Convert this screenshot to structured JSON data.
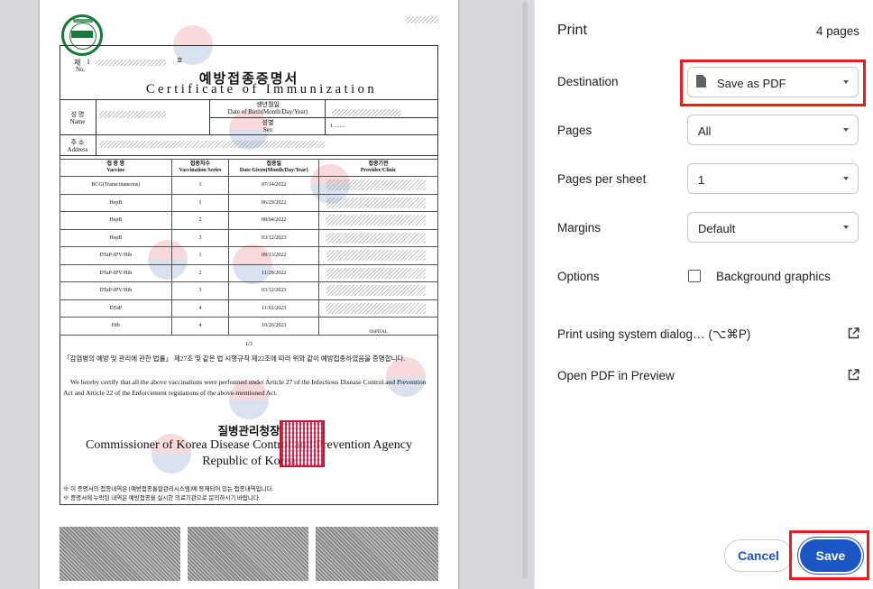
{
  "document": {
    "seal_text": "시 험 확 인 진본 2024-10 YO 17:25:06 KST 예방접종통합관리시스템",
    "number_prefix": "제",
    "number_value": "1",
    "number_suffix": "호",
    "number_en": "No.",
    "title_ko": "예방접종증명서",
    "title_en": "Certificate of Immunization",
    "name_label_ko": "성  명",
    "name_label_en": "Name",
    "dob_label_ko": "생년월일",
    "dob_label_en": "Date of Birth(Month/Day/Year)",
    "sex_label_ko": "성별",
    "sex_label_en": "Sex",
    "sex_value": "1 ........",
    "address_label_ko": "주  소",
    "address_label_en": "Address",
    "table_headers": [
      {
        "ko": "접 종 명",
        "en": "Vaccine"
      },
      {
        "ko": "접종차수",
        "en": "Vaccination Series"
      },
      {
        "ko": "접종일",
        "en": "Date Given(Month/Day/Year)"
      },
      {
        "ko": "접종기관",
        "en": "Provider/Clinic"
      }
    ],
    "rows": [
      {
        "vaccine": "BCG(Transcutaneous)",
        "series": "1",
        "date": "07/14/2022"
      },
      {
        "vaccine": "HepB",
        "series": "1",
        "date": "06/29/2022"
      },
      {
        "vaccine": "HepB",
        "series": "2",
        "date": "08/04/2022"
      },
      {
        "vaccine": "HepB",
        "series": "3",
        "date": "03/12/2023"
      },
      {
        "vaccine": "DTaP-IPV/Hib",
        "series": "1",
        "date": "09/13/2022"
      },
      {
        "vaccine": "DTaP-IPV/Hib",
        "series": "2",
        "date": "11/28/2022"
      },
      {
        "vaccine": "DTaP-IPV/Hib",
        "series": "3",
        "date": "03/12/2023"
      },
      {
        "vaccine": "DTaP",
        "series": "4",
        "date": "11/02/2023"
      },
      {
        "vaccine": "Hib",
        "series": "4",
        "date": "10/26/2023"
      }
    ],
    "page_indicator": "1/3",
    "cert_text_ko": "「감염병의 예방 및 관리에 관한 법률」 제27조 및 같은 법 시행규칙 제22조에 따라 위와 같이 예방접종하였음을 증명합니다.",
    "cert_text_en": "We hereby certify that all the above vaccinations were performed under Article 27 of the Infectious Disease Control and Prevention Act and Article 22 of the Enforcement regulations of the above-mentioned Act.",
    "agency_ko": "질병관리청장",
    "agency_en": "Commissioner of Korea Disease Control and Prevention Agency",
    "country_en": "Republic of Korea",
    "footnote_1": "※ 이 증명서의 접종내역은 [예방접종통합관리시스템]에 등재되어 있는 접종내역입니다.",
    "footnote_2": "※ 증명서에 누락된 내역은 예방접종을 실시한 의료기관으로 문의하시기 바랍니다.",
    "clinic_fragment": "OSPITAL"
  },
  "panel": {
    "title": "Print",
    "page_count": "4 pages",
    "destination_label": "Destination",
    "destination_value": "Save as PDF",
    "pages_label": "Pages",
    "pages_value": "All",
    "pages_per_sheet_label": "Pages per sheet",
    "pages_per_sheet_value": "1",
    "margins_label": "Margins",
    "margins_value": "Default",
    "options_label": "Options",
    "background_graphics_label": "Background graphics",
    "background_graphics_checked": false,
    "system_dialog_label": "Print using system dialog… (⌥⌘P)",
    "open_preview_label": "Open PDF in Preview",
    "cancel_label": "Cancel",
    "save_label": "Save"
  },
  "colors": {
    "accent": "#1a56c4",
    "highlight": "#ee1b1b"
  }
}
